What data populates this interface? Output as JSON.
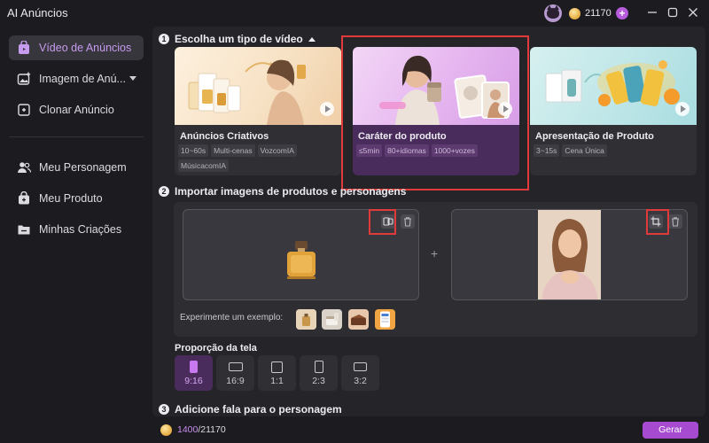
{
  "window": {
    "title": "AI Anúncios",
    "credits": "21170"
  },
  "sidebar": {
    "items": [
      {
        "label": "Vídeo de Anúncios",
        "active": true
      },
      {
        "label": "Imagem de Anú...",
        "has_dropdown": true
      },
      {
        "label": "Clonar Anúncio"
      },
      {
        "label": "Meu Personagem"
      },
      {
        "label": "Meu Produto"
      },
      {
        "label": "Minhas Criações"
      }
    ]
  },
  "step1": {
    "number": "1",
    "title": "Escolha um tipo de vídeo",
    "cards": [
      {
        "title": "Anúncios Criativos",
        "tags": [
          "10~60s",
          "Multi-cenas",
          "VozcomIA",
          "MúsicacomIA"
        ],
        "selected": false
      },
      {
        "title": "Caráter do produto",
        "tags": [
          "≤5min",
          "80+idiomas",
          "1000+vozes"
        ],
        "selected": true
      },
      {
        "title": "Apresentação de Produto",
        "tags": [
          "3~15s",
          "Cena Única"
        ],
        "selected": false
      }
    ]
  },
  "step2": {
    "number": "2",
    "title": "Importar imagens de produtos e personagens",
    "try_label": "Experimente um exemplo:",
    "plus": "+"
  },
  "ratio": {
    "title": "Proporção da tela",
    "options": [
      "9:16",
      "16:9",
      "1:1",
      "2:3",
      "3:2"
    ],
    "selected": "9:16"
  },
  "step3": {
    "number": "3",
    "title": "Adicione fala para o personagem"
  },
  "footer": {
    "credits_used": "1400",
    "credits_total": "/21170",
    "generate": "Gerar"
  },
  "colors": {
    "accent": "#a64bd0",
    "selected_card": "#4a2c5c",
    "highlight_box": "#e03a3a"
  }
}
